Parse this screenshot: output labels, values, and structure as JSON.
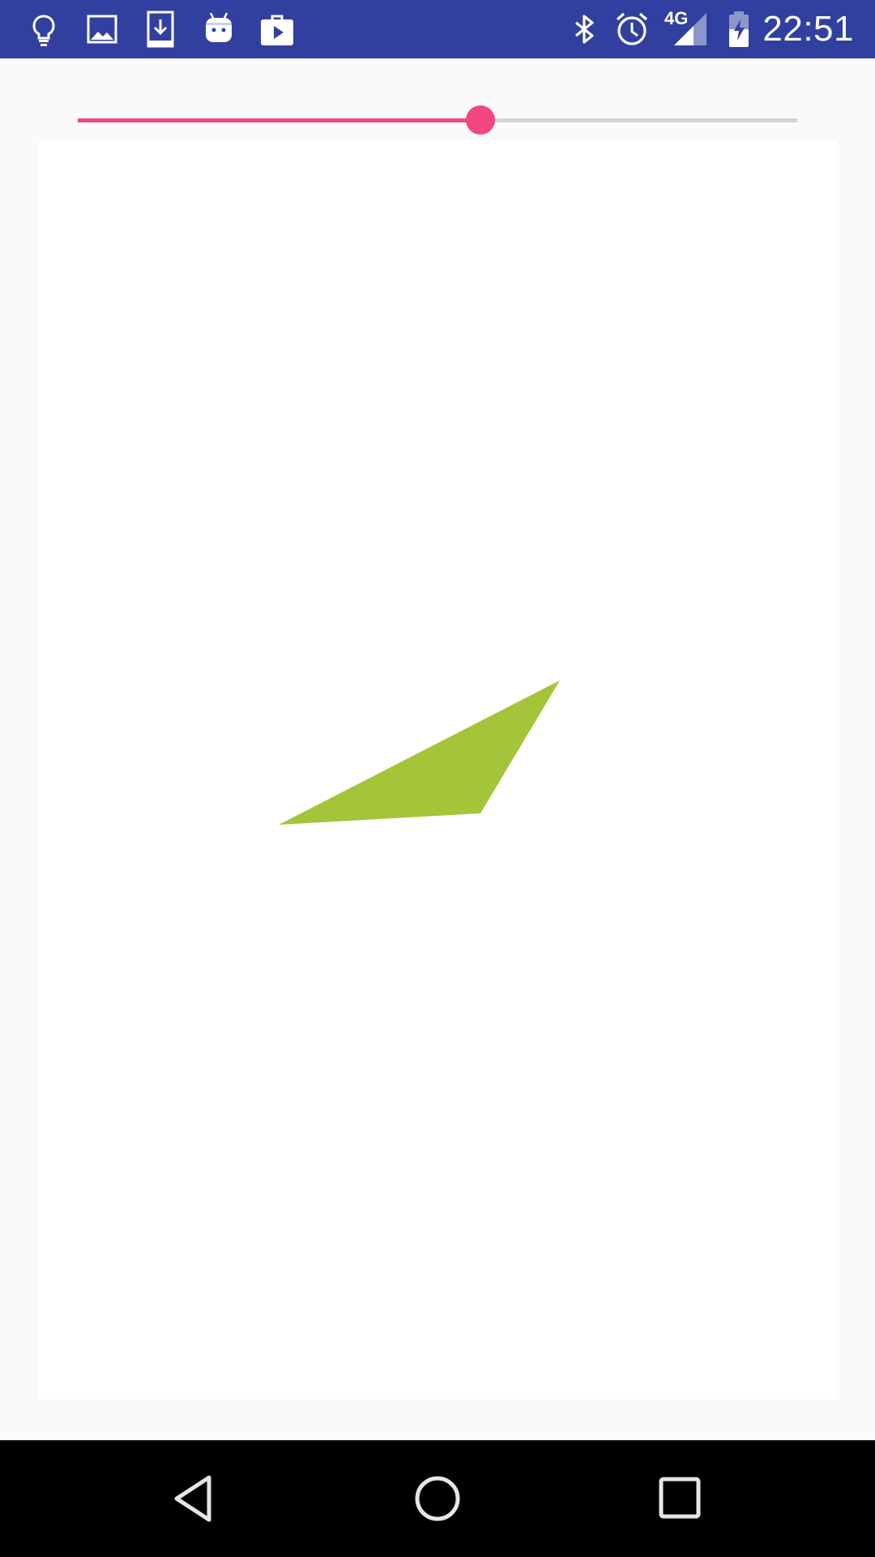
{
  "status_bar": {
    "time": "22:51",
    "network_label": "4G",
    "color": "#3140a0",
    "left_icons": [
      "lightbulb-icon",
      "image-icon",
      "download-icon",
      "android-icon",
      "play-store-icon"
    ],
    "right_icons": [
      "bluetooth-icon",
      "alarm-icon",
      "signal-icon",
      "battery-charging-icon"
    ]
  },
  "slider": {
    "value_fraction": 0.56,
    "accent_color": "#f2477f",
    "track_color": "#d6d6d6"
  },
  "canvas": {
    "background": "#ffffff",
    "shape": {
      "type": "triangle",
      "fill": "#a4c43a"
    }
  },
  "nav_bar": {
    "buttons": [
      "back-icon",
      "home-icon",
      "recents-icon"
    ]
  }
}
